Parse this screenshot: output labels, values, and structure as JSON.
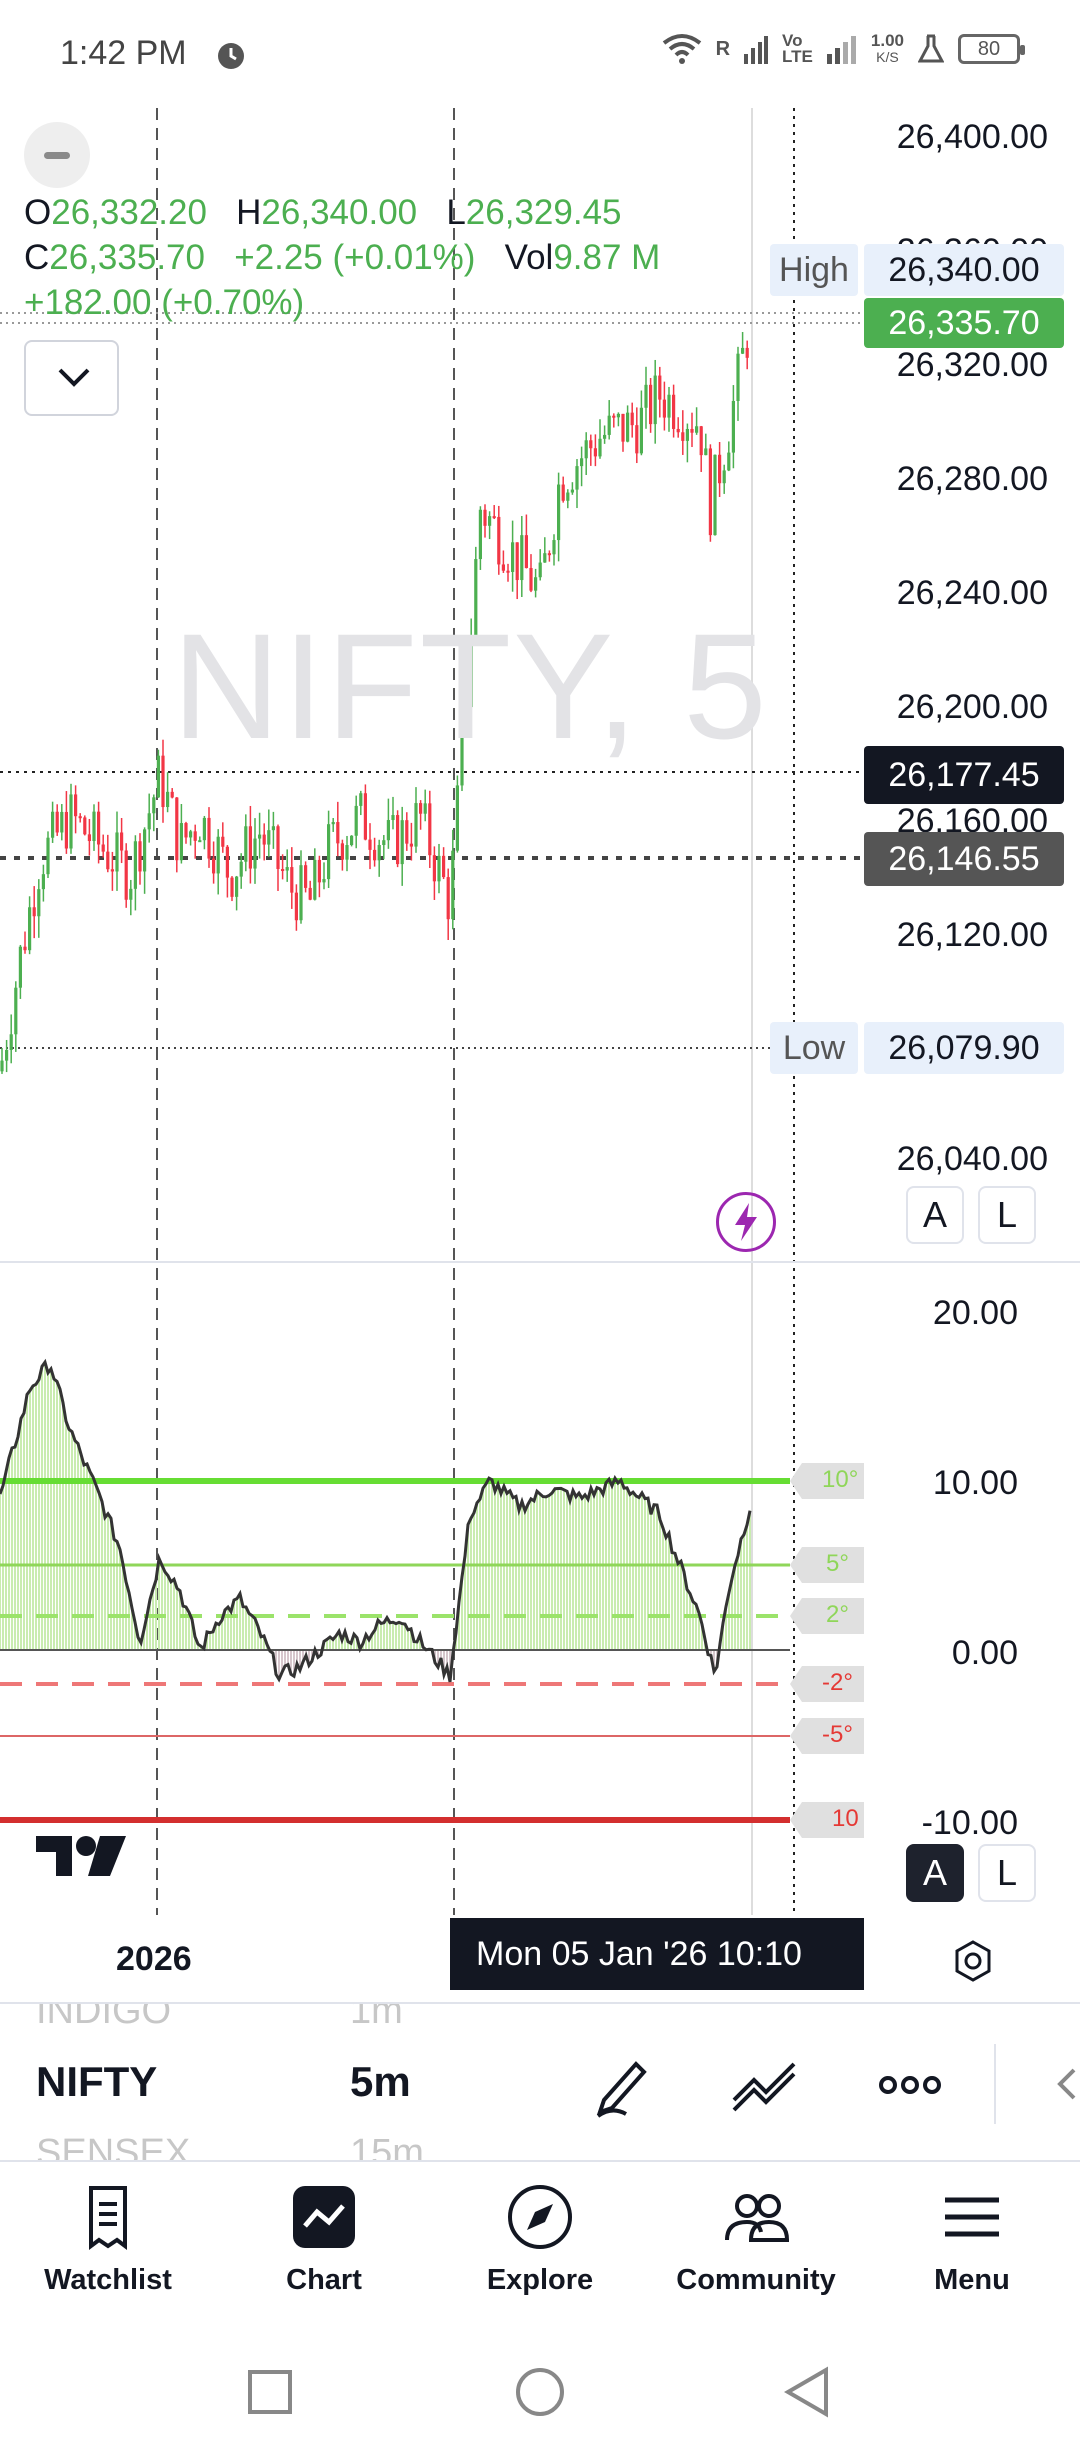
{
  "status": {
    "time": "1:42 PM",
    "net1": "R",
    "net2": "Vo\nLTE",
    "speed_value": "1.00",
    "speed_unit": "K/S",
    "battery": "80"
  },
  "chart": {
    "watermark": "NIFTY, 5",
    "ohlc": {
      "o_label": "O",
      "o_value": "26,332.20",
      "h_label": "H",
      "h_value": "26,340.00",
      "l_label": "L",
      "l_value": "26,329.45",
      "c_label": "C",
      "c_value": "26,335.70",
      "change": "+2.25 (+0.01%)",
      "vol_label": "Vol",
      "vol_value": "9.87 M",
      "day_change": "+182.00 (+0.70%)"
    },
    "price_scale": [
      "26,400.00",
      "26,360.00",
      "26,320.00",
      "26,280.00",
      "26,240.00",
      "26,200.00",
      "26,160.00",
      "26,120.00",
      "26,040.00"
    ],
    "high_label": "High",
    "high_value": "26,340.00",
    "last_price": "26,335.70",
    "crosshair_price": "26,177.45",
    "prev_close": "26,146.55",
    "low_label": "Low",
    "low_value": "26,079.90",
    "auto_label": "A",
    "log_label": "L",
    "colors": {
      "up": "#4caf50",
      "down": "#f23645",
      "last": "#4caf50"
    }
  },
  "oscillator": {
    "scale": [
      "20.00",
      "10.00",
      "0.00",
      "-10.00"
    ],
    "levels": [
      "10°",
      "5°",
      "2°",
      "-2°",
      "-5°",
      "10"
    ],
    "auto_label": "A",
    "log_label": "L",
    "icon": "tradingview-logo"
  },
  "time_axis": {
    "year": "2026",
    "crosshair_time": "Mon 05 Jan '26   10:10"
  },
  "symbols": {
    "prev_symbol": "INDIGO",
    "prev_interval": "1m",
    "symbol": "NIFTY",
    "interval": "5m",
    "next_symbol": "SENSEX",
    "next_interval": "15m"
  },
  "nav": [
    {
      "label": "Watchlist",
      "icon": "watchlist-icon"
    },
    {
      "label": "Chart",
      "icon": "chart-icon"
    },
    {
      "label": "Explore",
      "icon": "compass-icon"
    },
    {
      "label": "Community",
      "icon": "community-icon"
    },
    {
      "label": "Menu",
      "icon": "menu-icon"
    }
  ]
}
